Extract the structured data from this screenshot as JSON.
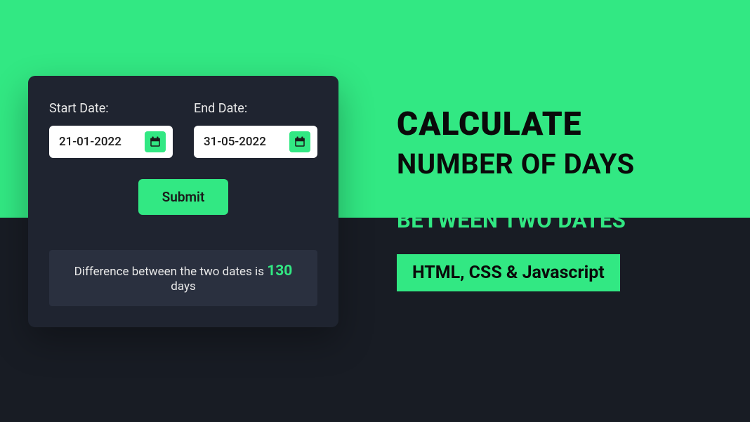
{
  "card": {
    "start_label": "Start Date:",
    "end_label": "End Date:",
    "start_value": "21-01-2022",
    "end_value": "31-05-2022",
    "submit_label": "Submit",
    "result_prefix": "Difference between the two dates is ",
    "result_number": "130",
    "result_suffix": " days"
  },
  "headline": {
    "line1": "CALCULATE",
    "line2": "NUMBER OF DAYS",
    "line3": "BETWEEN TWO DATES",
    "badge": "HTML, CSS & Javascript"
  },
  "colors": {
    "accent": "#32e883",
    "dark": "#181c24",
    "card": "#1f2430"
  }
}
